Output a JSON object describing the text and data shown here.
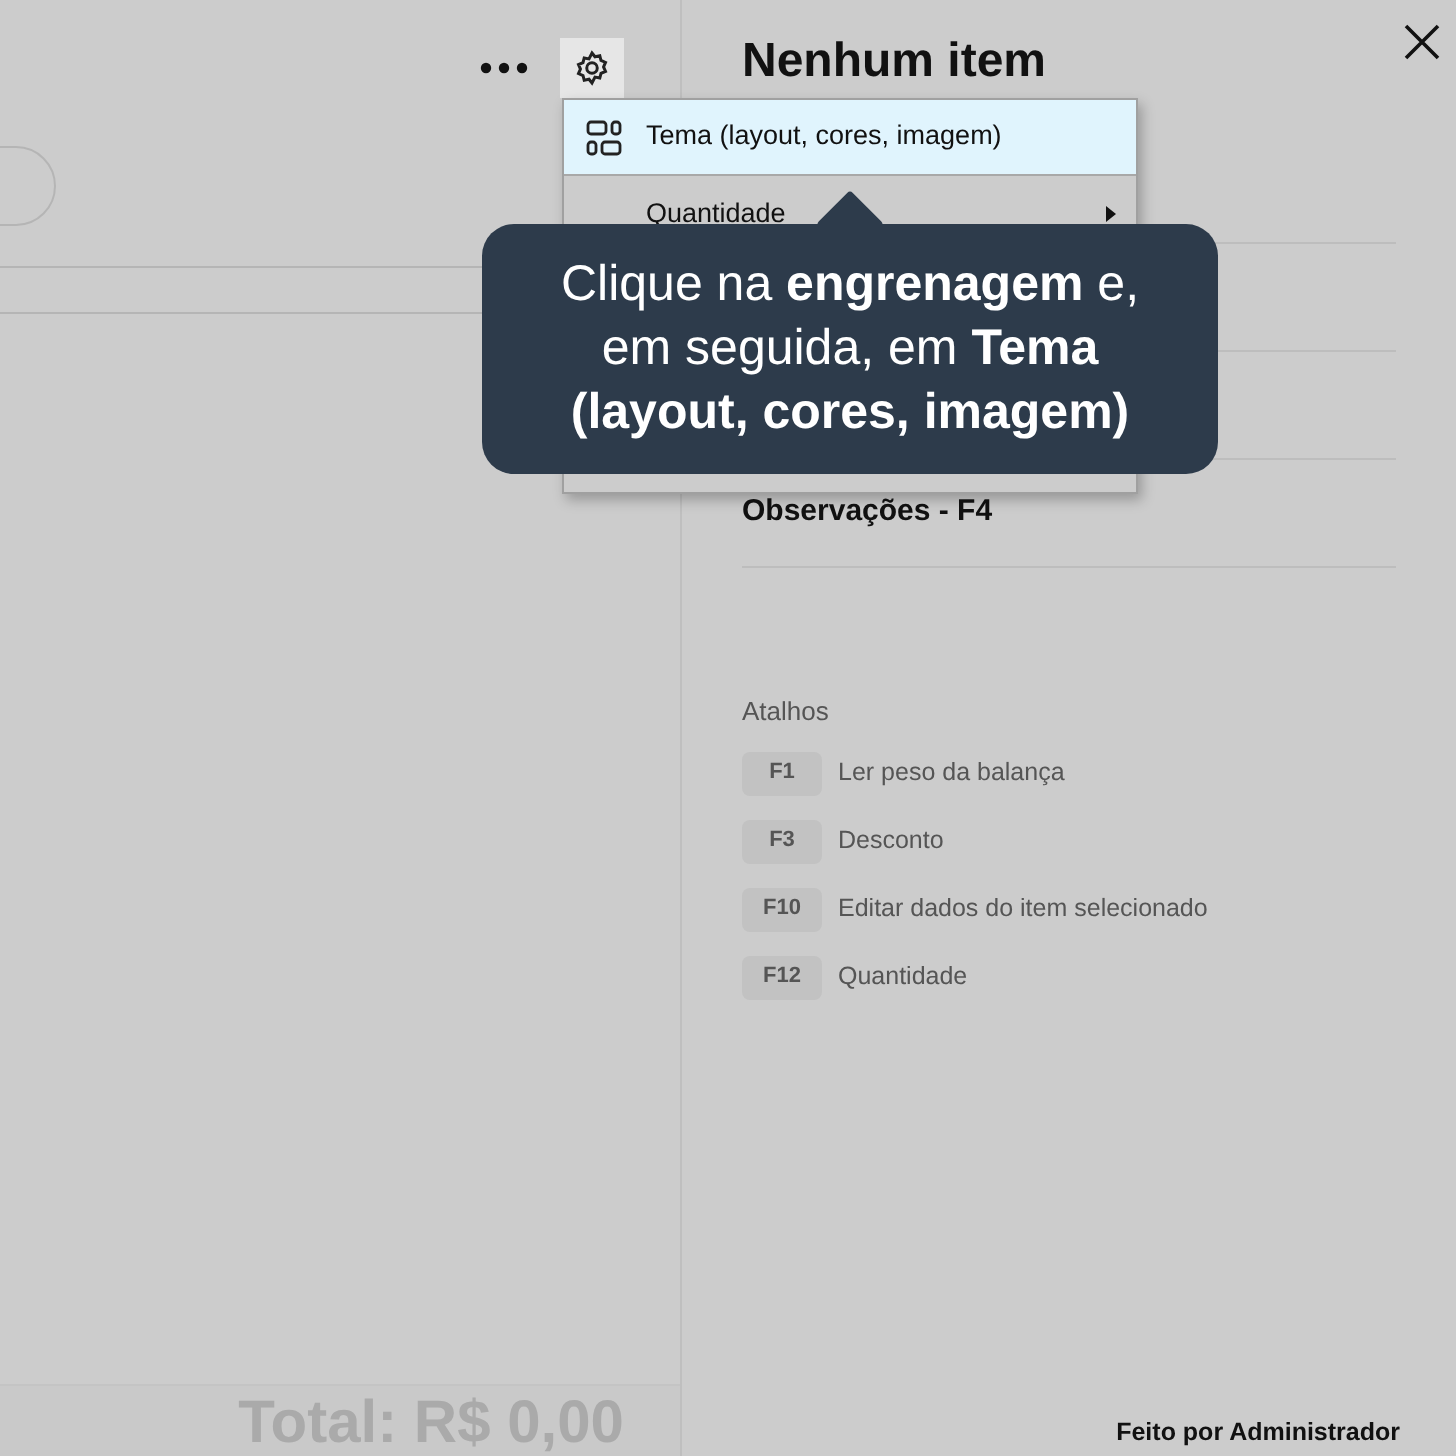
{
  "panel": {
    "title": "Nenhum item",
    "rows": [
      {
        "label": "Observações - F4"
      }
    ]
  },
  "menu": {
    "items": [
      {
        "label": "Tema (layout, cores, imagem)",
        "kind": "icon",
        "selected": true
      },
      {
        "label": "Quantidade",
        "kind": "submenu",
        "selected": false
      }
    ]
  },
  "tooltip": {
    "text": "Clique na **engrenagem** e, em seguida, em **Tema (layout, cores, imagem)**"
  },
  "shortcuts": {
    "title": "Atalhos",
    "items": [
      {
        "key": "F1",
        "label": "Ler peso da balança"
      },
      {
        "key": "F3",
        "label": "Desconto"
      },
      {
        "key": "F10",
        "label": "Editar dados do item selecionado"
      },
      {
        "key": "F12",
        "label": "Quantidade"
      }
    ]
  },
  "total": "Total: R$ 0,00",
  "footer": "Feito por Administrador"
}
